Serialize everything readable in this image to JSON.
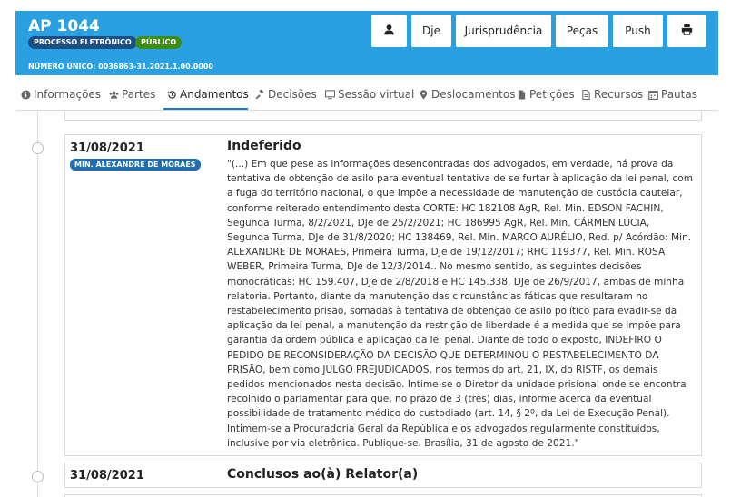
{
  "header": {
    "case_title": "AP 1044",
    "badge_processo": "PROCESSO ELETRÔNICO",
    "badge_publico": "PÚBLICO",
    "numero_unico": "NÚMERO ÚNICO: 0036863-31.2021.1.00.0000",
    "buttons": {
      "user_icon": "user-icon",
      "dje": "Dje",
      "jurisprudencia": "Jurisprudência",
      "pecas": "Peças",
      "push": "Push",
      "print_icon": "print-icon"
    },
    "color": "#2aa0e0"
  },
  "tabs": [
    {
      "label": "Informações",
      "icon": "info-icon"
    },
    {
      "label": "Partes",
      "icon": "users-icon"
    },
    {
      "label": "Andamentos",
      "icon": "history-icon",
      "active": true
    },
    {
      "label": "Decisões",
      "icon": "gavel-icon"
    },
    {
      "label": "Sessão virtual",
      "icon": "monitor-icon"
    },
    {
      "label": "Deslocamentos",
      "icon": "map-marker-icon"
    },
    {
      "label": "Petições",
      "icon": "file-icon"
    },
    {
      "label": "Recursos",
      "icon": "file-text-icon"
    },
    {
      "label": "Pautas",
      "icon": "calendar-icon"
    }
  ],
  "timeline": [
    {
      "date": "31/08/2021",
      "minister": "MIN. ALEXANDRE DE MORAES",
      "title": "Indeferido",
      "text": "\"(...) Em que pese as informações desencontradas dos advogados, em verdade, há prova da tentativa de obtenção de asilo para eventual tentativa de se furtar à aplicação da lei penal, com a fuga do território nacional, o que impõe a necessidade de manutenção de custódia cautelar, conforme reiterado entendimento desta CORTE: HC 182108 AgR, Rel. Min. EDSON FACHIN, Segunda Turma, 8/2/2021, DJe de 25/2/2021; HC 186995 AgR, Rel. Min. CÁRMEN LÚCIA, Segunda Turma, DJe de 31/8/2020; HC 138469, Rel. Min. MARCO AURÉLIO, Red. p/ Acórdão: Min. ALEXANDRE DE MORAES, Primeira Turma, DJe de 19/12/2017; RHC 119377, Rel. Min. ROSA WEBER, Primeira Turma, DJe de 12/3/2014.. No mesmo sentido, as seguintes decisões monocráticas: HC 159.407, DJe de 2/8/2018 e HC 145.338, DJe de 26/9/2017, ambas de minha relatoria. Portanto, diante da manutenção das circunstâncias fáticas que resultaram no restabelecimento prisão, somadas à tentativa de obtenção de asilo político para evadir-se da aplicação da lei penal, a manutenção da restrição de liberdade é a medida que se impõe para garantia da ordem pública e aplicação da lei penal. Diante de todo o exposto, INDEFIRO O PEDIDO DE RECONSIDERAÇÃO DA DECISÃO QUE DETERMINOU O RESTABELECIMENTO DA PRISÃO, bem como JULGO PREJUDICADOS, nos termos do art. 21, IX, do RISTF, os demais pedidos mencionados nesta decisão. Intime-se o Diretor da unidade prisional onde se encontra recolhido o parlamentar para que, no prazo de 3 (três) dias, informe acerca da eventual possibilidade de tratamento médico do custodiado (art. 14, § 2º, da Lei de Execução Penal). Intimem-se a Procuradoria Geral da República e os advogados regularmente constituídos, inclusive por via eletrônica. Publique-se. Brasília, 31 de agosto de 2021.\""
    },
    {
      "date": "31/08/2021",
      "title": "Conclusos ao(à) Relator(a)"
    }
  ]
}
